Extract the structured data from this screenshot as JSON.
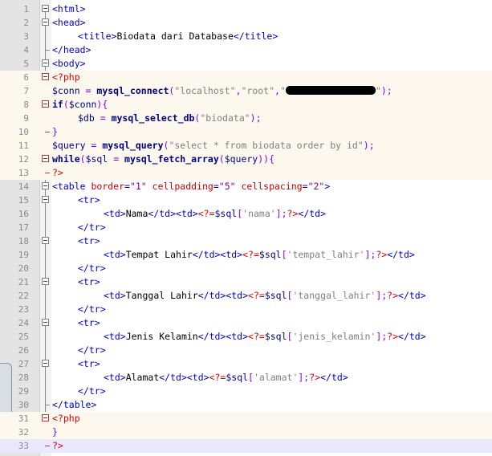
{
  "editor": {
    "current_line": 33,
    "lines": [
      {
        "n": "1"
      },
      {
        "n": "2"
      },
      {
        "n": "3"
      },
      {
        "n": "4"
      },
      {
        "n": "5"
      },
      {
        "n": "6"
      },
      {
        "n": "7"
      },
      {
        "n": "8"
      },
      {
        "n": "9"
      },
      {
        "n": "10"
      },
      {
        "n": "11"
      },
      {
        "n": "12"
      },
      {
        "n": "13"
      },
      {
        "n": "14"
      },
      {
        "n": "15"
      },
      {
        "n": "16"
      },
      {
        "n": "17"
      },
      {
        "n": "18"
      },
      {
        "n": "19"
      },
      {
        "n": "20"
      },
      {
        "n": "21"
      },
      {
        "n": "22"
      },
      {
        "n": "23"
      },
      {
        "n": "24"
      },
      {
        "n": "25"
      },
      {
        "n": "26"
      },
      {
        "n": "27"
      },
      {
        "n": "28"
      },
      {
        "n": "29"
      },
      {
        "n": "30"
      },
      {
        "n": "31"
      },
      {
        "n": "32"
      },
      {
        "n": "33"
      }
    ],
    "tokens": {
      "l1": [
        "<html>"
      ],
      "l2": [
        "<head>"
      ],
      "l3": [
        "<title>",
        "Biodata dari Database",
        "</title>"
      ],
      "l4": [
        "</head>"
      ],
      "l5": [
        "<body>"
      ],
      "l6": [
        "<?php"
      ],
      "l7": [
        "$conn",
        " = ",
        "mysql_connect",
        "(",
        "\"localhost\"",
        ",",
        "\"root\"",
        ",",
        "\"",
        "\"",
        ");"
      ],
      "l8": [
        "if",
        "(",
        "$conn",
        "){"
      ],
      "l9": [
        "$db",
        " = ",
        "mysql_select_db",
        "(",
        "\"biodata\"",
        ");"
      ],
      "l10": [
        "}"
      ],
      "l11": [
        "$query",
        " = ",
        "mysql_query",
        "(",
        "\"select * from biodata order by id\"",
        ");"
      ],
      "l12": [
        "while",
        "(",
        "$sql",
        " = ",
        "mysql_fetch_array",
        "(",
        "$query",
        ")){"
      ],
      "l13": [
        "?>"
      ],
      "l14": [
        "<table",
        " border",
        "=",
        "\"1\"",
        " cellpadding",
        "=",
        "\"5\"",
        " cellspacing",
        "=",
        "\"2\"",
        ">"
      ],
      "l15": [
        "<tr>"
      ],
      "l16": [
        "<td>",
        "Nama",
        "</td><td>",
        "<?=",
        "$sql",
        "[",
        "'nama'",
        "];",
        "?>",
        "</td>"
      ],
      "l17": [
        "</tr>"
      ],
      "l18": [
        "<tr>"
      ],
      "l19": [
        "<td>",
        "Tempat Lahir",
        "</td><td>",
        "<?=",
        "$sql",
        "[",
        "'tempat_lahir'",
        "];",
        "?>",
        "</td>"
      ],
      "l20": [
        "</tr>"
      ],
      "l21": [
        "<tr>"
      ],
      "l22": [
        "<td>",
        "Tanggal Lahir",
        "</td><td>",
        "<?=",
        "$sql",
        "[",
        "'tanggal_lahir'",
        "];",
        "?>",
        "</td>"
      ],
      "l23": [
        "</tr>"
      ],
      "l24": [
        "<tr>"
      ],
      "l25": [
        "<td>",
        "Jenis Kelamin",
        "</td><td>",
        "<?=",
        "$sql",
        "[",
        "'jenis_kelamin'",
        "];",
        "?>",
        "</td>"
      ],
      "l26": [
        "</tr>"
      ],
      "l27": [
        "<tr>"
      ],
      "l28": [
        "<td>",
        "Alamat",
        "</td><td>",
        "<?=",
        "$sql",
        "[",
        "'alamat'",
        "];",
        "?>",
        "</td>"
      ],
      "l29": [
        "</tr>"
      ],
      "l30": [
        "</table>"
      ],
      "l31": [
        "<?php"
      ],
      "l32": [
        "}"
      ],
      "l33": [
        "?>"
      ]
    }
  },
  "colors": {
    "tag": "#0000cc",
    "attribute": "#cc0000",
    "php_delimiter": "#dd0000",
    "string": "#808080",
    "php_line_bg": "#fdf8ee",
    "current_line_bg": "#e8e8ff"
  },
  "icons": {
    "fold_marker": "square-minus-icon",
    "redaction": "redacted-password"
  }
}
